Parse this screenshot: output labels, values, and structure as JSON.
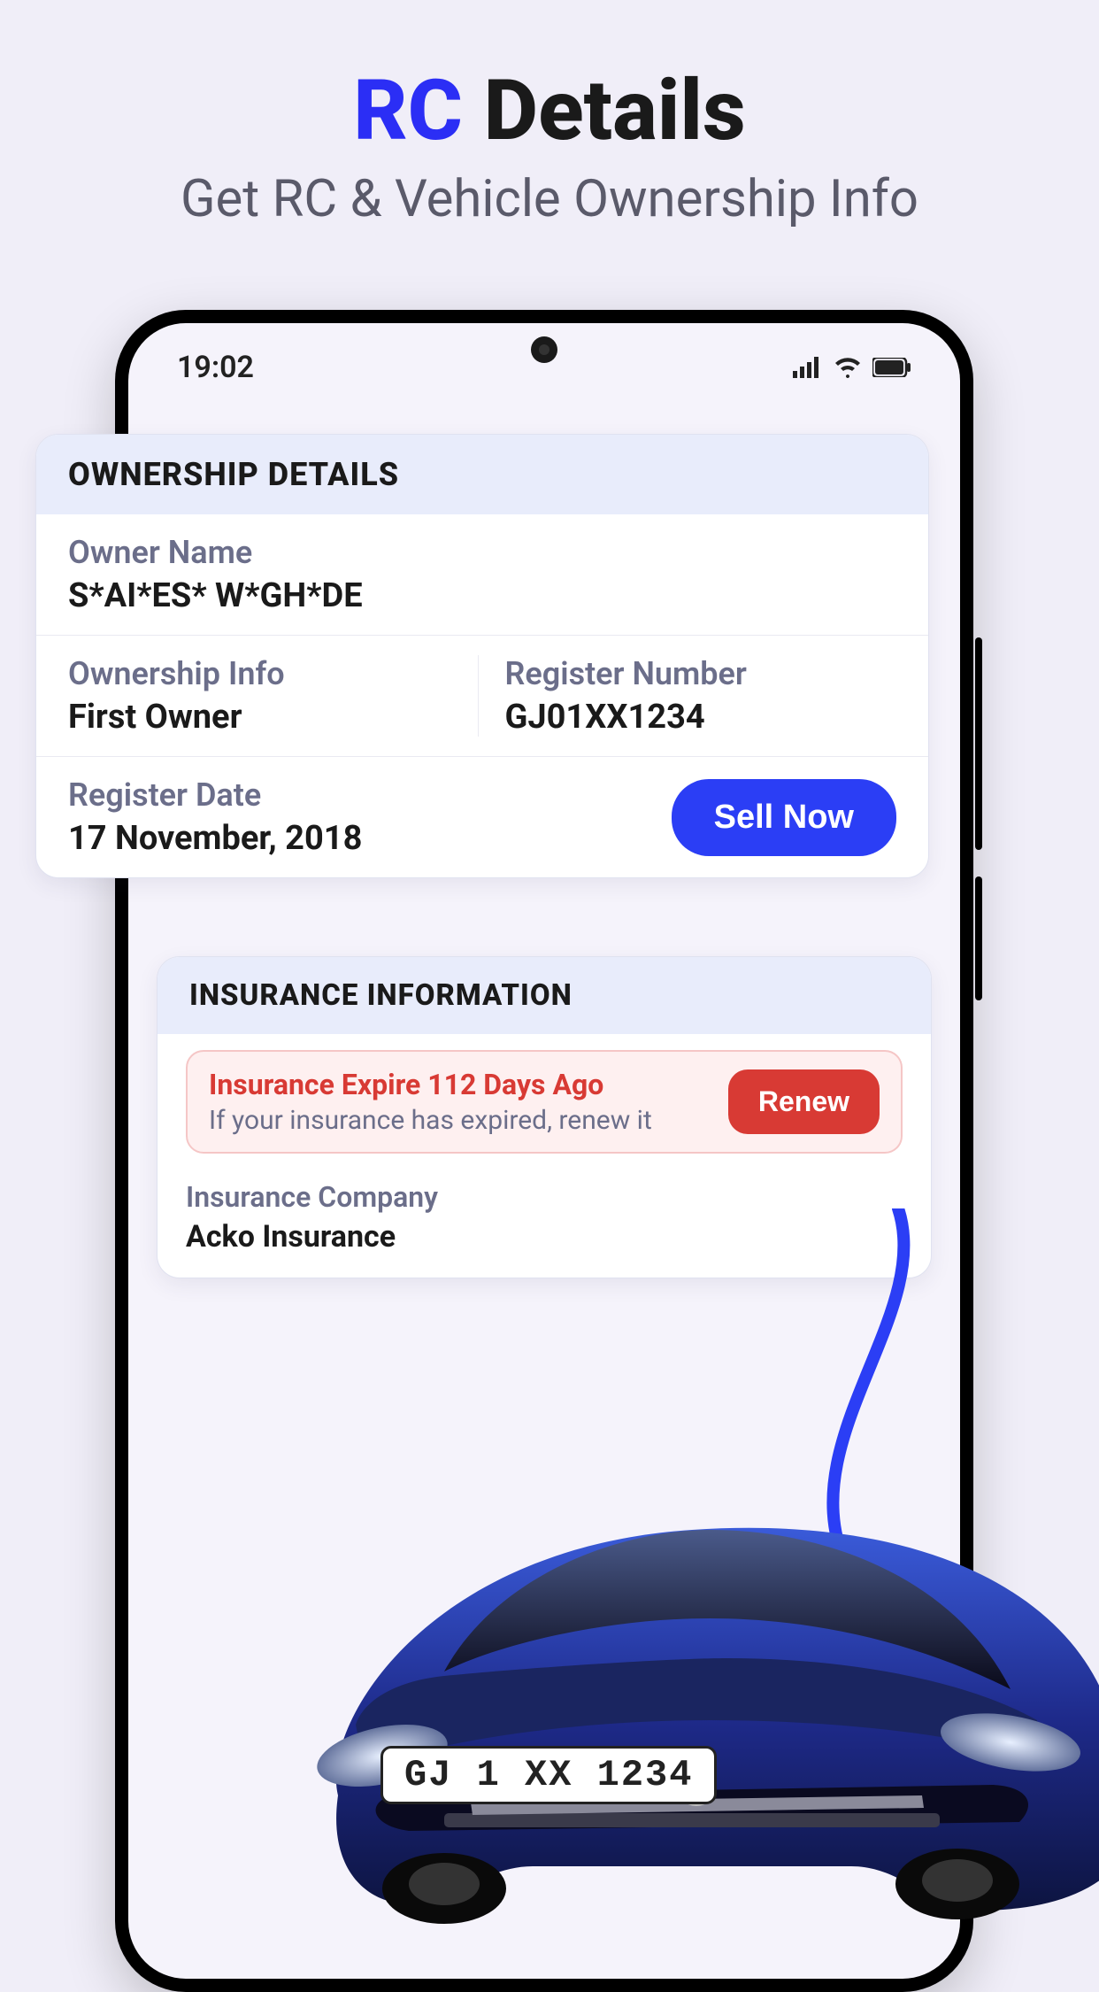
{
  "page": {
    "title_prefix": "RC",
    "title_suffix": " Details",
    "subtitle": "Get RC & Vehicle Ownership Info"
  },
  "status_bar": {
    "time": "19:02"
  },
  "ownership": {
    "header": "OWNERSHIP DETAILS",
    "owner_name_label": "Owner Name",
    "owner_name_value": "S*AI*ES* W*GH*DE",
    "ownership_info_label": "Ownership Info",
    "ownership_info_value": "First Owner",
    "register_number_label": "Register Number",
    "register_number_value": "GJ01XX1234",
    "register_date_label": "Register Date",
    "register_date_value": "17 November, 2018",
    "sell_button": "Sell Now"
  },
  "insurance": {
    "header": "INSURANCE INFORMATION",
    "alert_title": "Insurance Expire 112 Days Ago",
    "alert_sub": "If your insurance has expired, renew it",
    "renew_button": "Renew",
    "company_label": "Insurance Company",
    "company_value": "Acko Insurance"
  },
  "car": {
    "license_plate": "GJ 1 XX 1234"
  }
}
